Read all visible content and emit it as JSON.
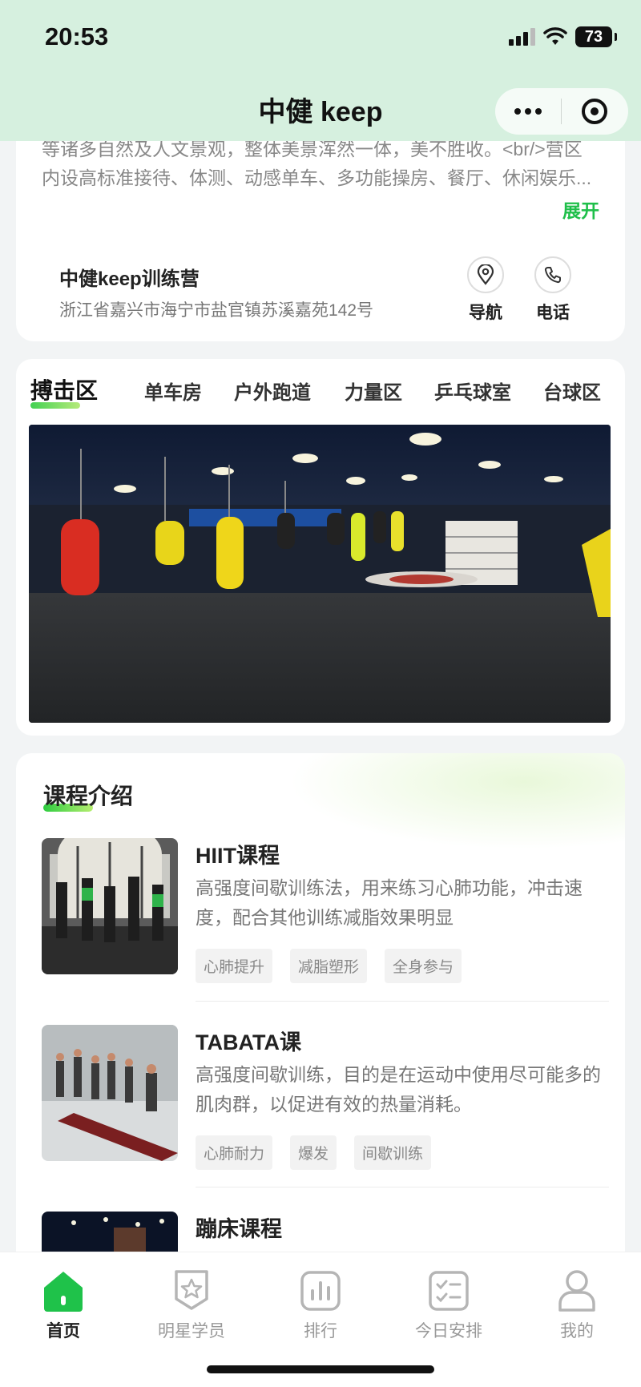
{
  "status_bar": {
    "time": "20:53",
    "battery": "73"
  },
  "nav": {
    "title": "中健 keep"
  },
  "intro": {
    "text_line1": "等诸多自然及人文景观，整体美景浑然一体，美不胜收。<br/>营区",
    "text_line2": "内设高标准接待、体测、动感单车、多功能操房、餐厅、休闲娱乐...",
    "expand_label": "展开",
    "camp_name": "中健keep训练营",
    "address": "浙江省嘉兴市海宁市盐官镇苏溪嘉苑142号",
    "nav_label": "导航",
    "phone_label": "电话"
  },
  "zones": {
    "tabs": [
      "搏击区",
      "单车房",
      "户外跑道",
      "力量区",
      "乒乓球室",
      "台球区"
    ],
    "active_tab": "搏击区"
  },
  "courses": {
    "title": "课程介绍",
    "items": [
      {
        "title": "HIIT课程",
        "description": "高强度间歇训练法，用来练习心肺功能，冲击速度，配合其他训练减脂效果明显",
        "tags": [
          "心肺提升",
          "减脂塑形",
          "全身参与"
        ]
      },
      {
        "title": "TABATA课",
        "description": "高强度间歇训练，目的是在运动中使用尽可能多的肌肉群，以促进有效的热量消耗。",
        "tags": [
          "心肺耐力",
          "爆发",
          "间歇训练"
        ]
      },
      {
        "title": "蹦床课程",
        "description": "",
        "tags": []
      }
    ]
  },
  "tabbar": {
    "items": [
      "首页",
      "明星学员",
      "排行",
      "今日安排",
      "我的"
    ],
    "active": "首页"
  },
  "colors": {
    "accent": "#1fbf4a",
    "header_bg": "#d6f0df"
  }
}
